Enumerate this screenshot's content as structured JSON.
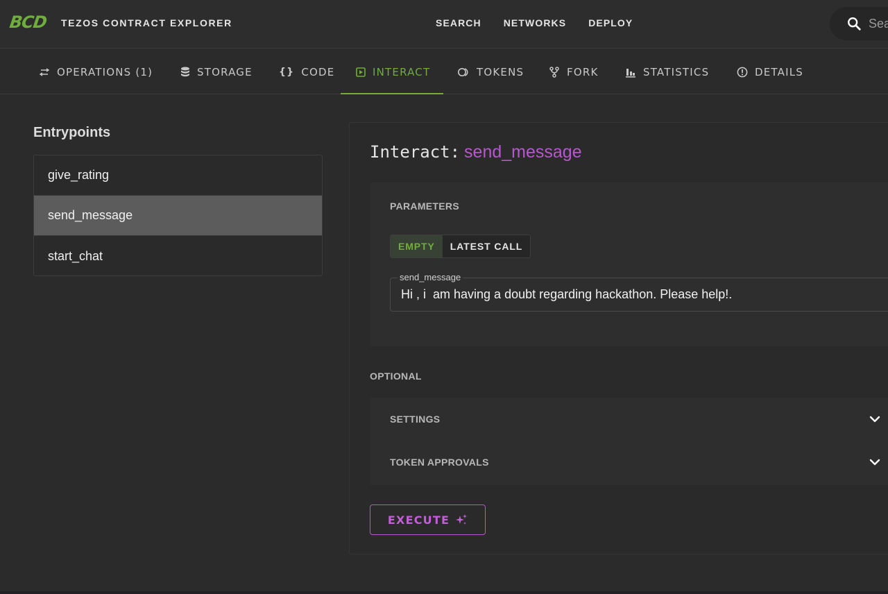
{
  "header": {
    "logo": "BCD",
    "app_title": "TEZOS CONTRACT EXPLORER",
    "nav": [
      "SEARCH",
      "NETWORKS",
      "DEPLOY"
    ],
    "search_placeholder": "Search",
    "search_icon": "search-icon"
  },
  "tabs": [
    {
      "label": "OPERATIONS (1)",
      "icon": "swap-arrows-icon"
    },
    {
      "label": "STORAGE",
      "icon": "database-icon"
    },
    {
      "label": "CODE",
      "icon": "code-braces-icon"
    },
    {
      "label": "INTERACT",
      "icon": "play-box-icon",
      "active": true
    },
    {
      "label": "TOKENS",
      "icon": "tokens-icon"
    },
    {
      "label": "FORK",
      "icon": "fork-icon"
    },
    {
      "label": "STATISTICS",
      "icon": "bar-chart-icon"
    },
    {
      "label": "DETAILS",
      "icon": "info-circle-icon"
    }
  ],
  "entrypoints": {
    "heading": "Entrypoints",
    "items": [
      "give_rating",
      "send_message",
      "start_chat"
    ],
    "selected": "send_message"
  },
  "interact": {
    "title_prefix": "Interact:",
    "entrypoint_name": "send_message",
    "parameters_label": "PARAMETERS",
    "toggle": {
      "empty": "EMPTY",
      "latest_call": "LATEST CALL",
      "active": "EMPTY"
    },
    "field_label": "send_message",
    "field_value": "Hi , i  am having a doubt regarding hackathon. Please help!.",
    "optional_label": "OPTIONAL",
    "settings_label": "SETTINGS",
    "token_approvals_label": "TOKEN APPROVALS",
    "execute_label": "EXECUTE"
  },
  "colors": {
    "accent_green": "#6fae3d",
    "accent_purple": "#b857cf",
    "background": "#2b2b2b",
    "selected_row": "#5c5c5c"
  }
}
